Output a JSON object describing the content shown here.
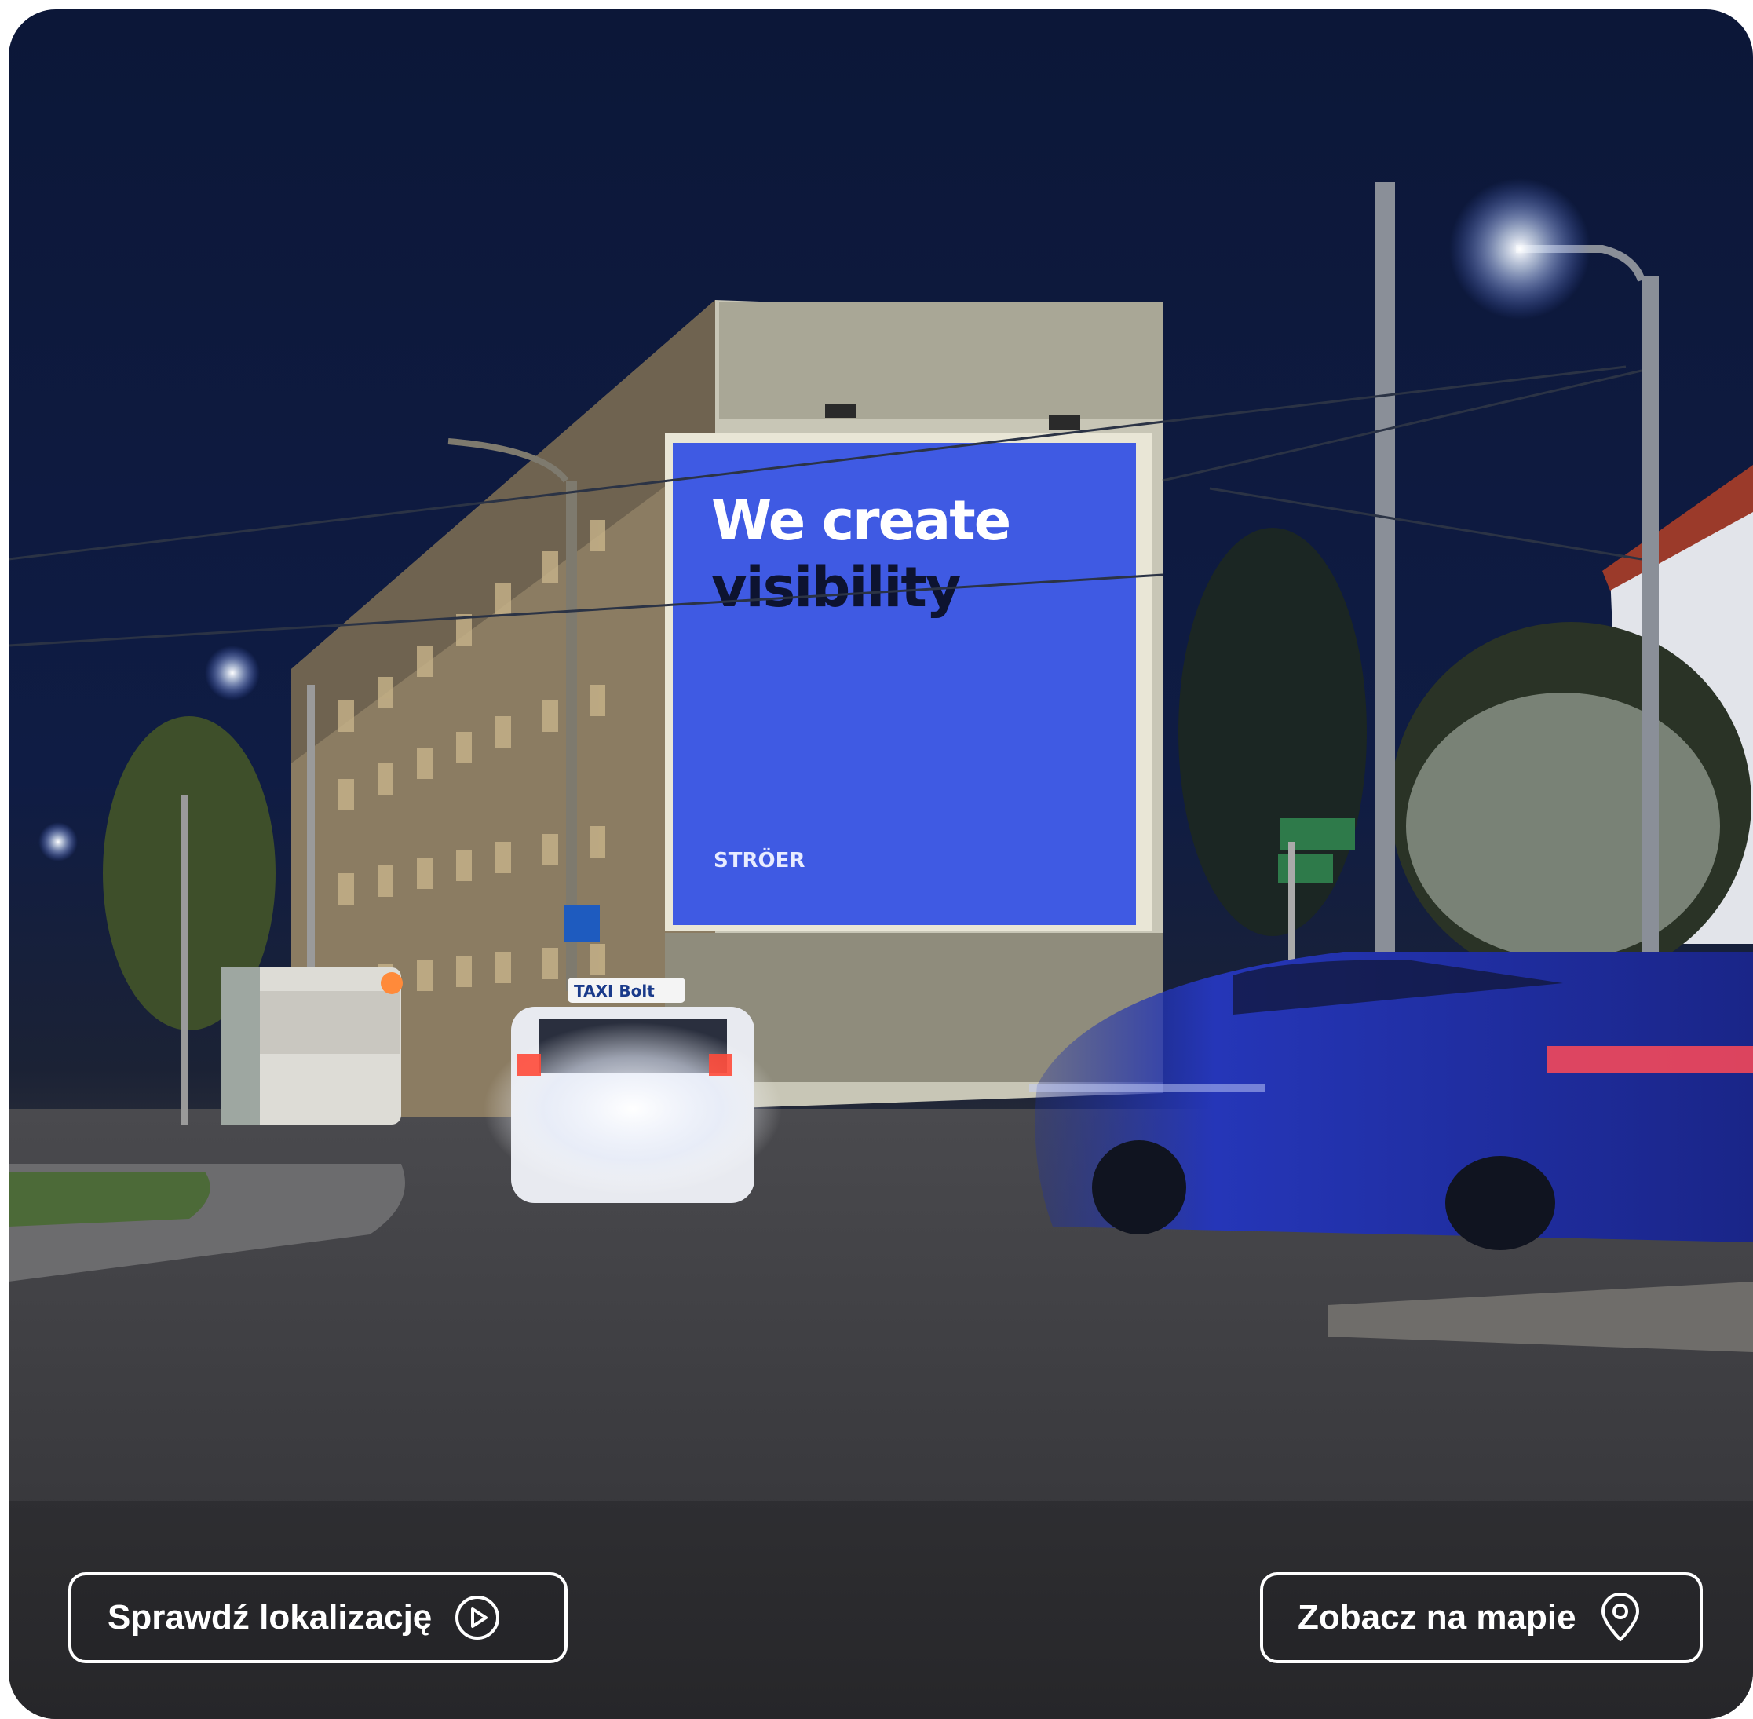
{
  "photo": {
    "billboard": {
      "headline_line1": "We create",
      "headline_line2": "visibility",
      "brand": "STRÖER",
      "color": "#3f5ae3"
    },
    "taxi_sign": "TAXI Bolt"
  },
  "actions": {
    "check_location_label": "Sprawdź lokalizację",
    "check_location_icon": "play-circle-icon",
    "view_map_label": "Zobacz na mapie",
    "view_map_icon": "map-pin-icon"
  }
}
